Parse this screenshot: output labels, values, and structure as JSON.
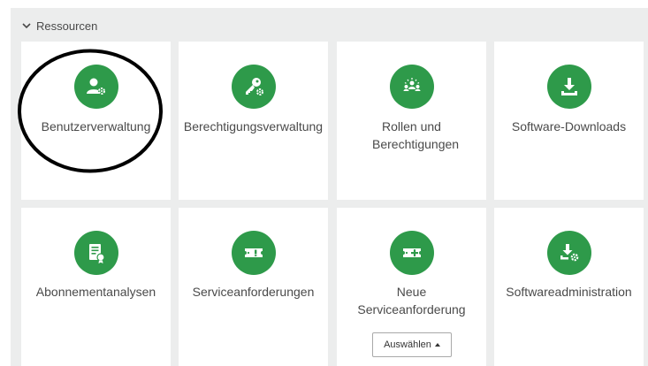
{
  "section": {
    "title": "Ressourcen",
    "expanded": true
  },
  "tiles": [
    {
      "label": "Benutzerverwaltung",
      "icon": "user-gear-icon"
    },
    {
      "label": "Berechtigungsverwaltung",
      "icon": "key-gear-icon"
    },
    {
      "label": "Rollen und Berechtigungen",
      "icon": "group-icon"
    },
    {
      "label": "Software-Downloads",
      "icon": "download-icon"
    },
    {
      "label": "Abonnementanalysen",
      "icon": "certificate-icon"
    },
    {
      "label": "Serviceanforderungen",
      "icon": "ticket-alert-icon"
    },
    {
      "label": "Neue Serviceanforderung",
      "icon": "ticket-plus-icon"
    },
    {
      "label": "Softwareadministration",
      "icon": "download-gear-icon"
    }
  ],
  "select_button": {
    "label": "Auswählen"
  },
  "colors": {
    "accent": "#2e9a4a",
    "panel": "#eceded",
    "text": "#4a4a4a",
    "annotation": "#000000"
  }
}
